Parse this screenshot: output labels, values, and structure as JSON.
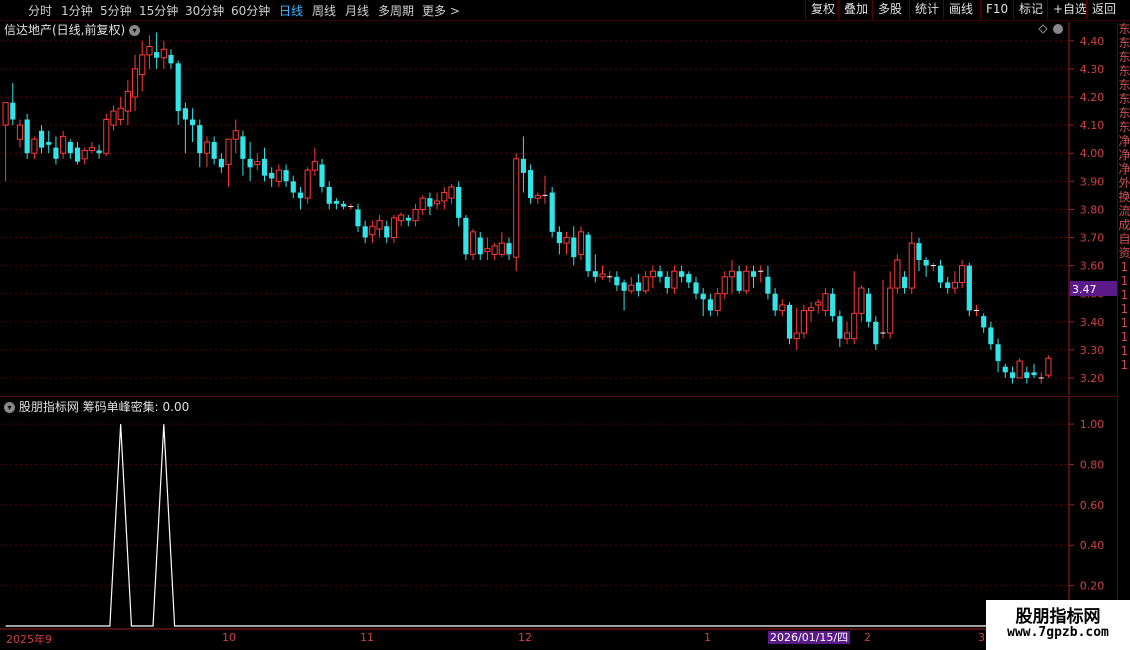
{
  "toolbar": {
    "periods": [
      "分时",
      "1分钟",
      "5分钟",
      "15分钟",
      "30分钟",
      "60分钟",
      "日线",
      "周线",
      "月线",
      "多周期",
      "更多 >"
    ],
    "active_period": "日线",
    "buttons": [
      "复权",
      "叠加",
      "多股",
      "统计",
      "画线",
      "F10",
      "标记",
      "+自选",
      "返回"
    ]
  },
  "chart": {
    "title": "信达地产(日线,前复权)",
    "current_price_tag": "3.47",
    "price_ticks": [
      "4.40",
      "4.30",
      "4.20",
      "4.10",
      "4.00",
      "3.90",
      "3.80",
      "3.70",
      "3.60",
      "3.50",
      "3.40",
      "3.30",
      "3.20"
    ]
  },
  "indicator": {
    "title": "股朋指标网  筹码单峰密集: 0.00",
    "ticks": [
      "1.00",
      "0.80",
      "0.60",
      "0.40",
      "0.20"
    ]
  },
  "xaxis": {
    "labels": [
      "2025年9",
      "10",
      "11",
      "12",
      "1",
      "2",
      "3"
    ],
    "cursor_date": "2026/01/15/四"
  },
  "right_strip": [
    "东",
    "东",
    "东",
    "东",
    "东",
    "东",
    "东",
    "东",
    "净",
    "净",
    "净",
    "外",
    "换",
    "流",
    "成",
    "自",
    "资",
    "1",
    "1",
    "1",
    "1",
    "1",
    "1",
    "1",
    "1"
  ],
  "watermark": {
    "name": "股朋指标网",
    "url": "www.7gpzb.com"
  },
  "colors": {
    "up": "#ff3a3a",
    "down": "#31e4e8",
    "grid": "#5a0000",
    "axis": "#d04040",
    "cursor": "#5a1a8a"
  },
  "chart_data": {
    "type": "candlestick",
    "title": "信达地产(日线,前复权)",
    "ylim": [
      3.15,
      4.46
    ],
    "candles": [
      [
        4.1,
        4.18,
        3.9,
        4.18
      ],
      [
        4.18,
        4.12,
        4.1,
        4.25
      ],
      [
        4.05,
        4.1,
        4.02,
        4.12
      ],
      [
        4.12,
        4.0,
        3.98,
        4.14
      ],
      [
        4.0,
        4.05,
        3.98,
        4.06
      ],
      [
        4.08,
        4.02,
        4.0,
        4.1
      ],
      [
        4.04,
        4.03,
        4.0,
        4.08
      ],
      [
        4.02,
        3.98,
        3.96,
        4.06
      ],
      [
        4.0,
        4.06,
        3.98,
        4.08
      ],
      [
        4.04,
        4.0,
        3.98,
        4.05
      ],
      [
        4.02,
        3.97,
        3.96,
        4.04
      ],
      [
        3.98,
        4.01,
        3.96,
        4.02
      ],
      [
        4.01,
        4.02,
        4.0,
        4.04
      ],
      [
        4.01,
        4.0,
        3.98,
        4.03
      ],
      [
        4.0,
        4.12,
        3.99,
        4.14
      ],
      [
        4.1,
        4.15,
        4.08,
        4.17
      ],
      [
        4.12,
        4.16,
        4.1,
        4.2
      ],
      [
        4.15,
        4.22,
        4.1,
        4.26
      ],
      [
        4.2,
        4.3,
        4.15,
        4.35
      ],
      [
        4.28,
        4.35,
        4.22,
        4.4
      ],
      [
        4.35,
        4.38,
        4.3,
        4.42
      ],
      [
        4.36,
        4.34,
        4.3,
        4.43
      ],
      [
        4.34,
        4.37,
        4.3,
        4.4
      ],
      [
        4.35,
        4.32,
        4.3,
        4.37
      ],
      [
        4.32,
        4.15,
        4.1,
        4.33
      ],
      [
        4.16,
        4.12,
        4.0,
        4.18
      ],
      [
        4.12,
        4.1,
        4.04,
        4.16
      ],
      [
        4.1,
        4.0,
        3.95,
        4.12
      ],
      [
        4.0,
        4.04,
        3.95,
        4.06
      ],
      [
        4.04,
        3.98,
        3.96,
        4.06
      ],
      [
        3.98,
        3.95,
        3.93,
        4.0
      ],
      [
        3.96,
        4.05,
        3.88,
        4.05
      ],
      [
        4.05,
        4.08,
        4.0,
        4.12
      ],
      [
        4.06,
        3.98,
        3.92,
        4.08
      ],
      [
        3.98,
        3.95,
        3.9,
        4.04
      ],
      [
        3.96,
        3.97,
        3.94,
        4.0
      ],
      [
        3.98,
        3.92,
        3.9,
        4.02
      ],
      [
        3.93,
        3.91,
        3.88,
        3.95
      ],
      [
        3.9,
        3.94,
        3.88,
        3.96
      ],
      [
        3.94,
        3.9,
        3.88,
        3.96
      ],
      [
        3.9,
        3.86,
        3.84,
        3.92
      ],
      [
        3.86,
        3.84,
        3.8,
        3.88
      ],
      [
        3.84,
        3.94,
        3.82,
        3.95
      ],
      [
        3.94,
        3.97,
        3.92,
        4.02
      ],
      [
        3.96,
        3.88,
        3.86,
        3.98
      ],
      [
        3.88,
        3.82,
        3.8,
        3.9
      ],
      [
        3.83,
        3.82,
        3.8,
        3.84
      ],
      [
        3.82,
        3.81,
        3.8,
        3.83
      ],
      [
        3.81,
        3.81,
        3.8,
        3.82
      ],
      [
        3.8,
        3.74,
        3.72,
        3.82
      ],
      [
        3.74,
        3.7,
        3.68,
        3.76
      ],
      [
        3.71,
        3.74,
        3.68,
        3.76
      ],
      [
        3.73,
        3.76,
        3.7,
        3.78
      ],
      [
        3.74,
        3.7,
        3.68,
        3.76
      ],
      [
        3.7,
        3.77,
        3.68,
        3.78
      ],
      [
        3.76,
        3.78,
        3.74,
        3.79
      ],
      [
        3.77,
        3.76,
        3.74,
        3.78
      ],
      [
        3.76,
        3.8,
        3.74,
        3.82
      ],
      [
        3.8,
        3.84,
        3.78,
        3.85
      ],
      [
        3.84,
        3.81,
        3.78,
        3.86
      ],
      [
        3.82,
        3.83,
        3.8,
        3.86
      ],
      [
        3.83,
        3.86,
        3.8,
        3.88
      ],
      [
        3.84,
        3.88,
        3.82,
        3.89
      ],
      [
        3.88,
        3.77,
        3.74,
        3.9
      ],
      [
        3.77,
        3.64,
        3.62,
        3.78
      ],
      [
        3.64,
        3.72,
        3.62,
        3.73
      ],
      [
        3.7,
        3.64,
        3.62,
        3.72
      ],
      [
        3.65,
        3.66,
        3.62,
        3.7
      ],
      [
        3.64,
        3.67,
        3.62,
        3.68
      ],
      [
        3.64,
        3.68,
        3.63,
        3.72
      ],
      [
        3.68,
        3.64,
        3.62,
        3.7
      ],
      [
        3.63,
        3.98,
        3.58,
        4.0
      ],
      [
        3.98,
        3.93,
        3.86,
        4.06
      ],
      [
        3.94,
        3.84,
        3.82,
        3.96
      ],
      [
        3.84,
        3.85,
        3.82,
        3.86
      ],
      [
        3.85,
        3.85,
        3.82,
        3.92
      ],
      [
        3.86,
        3.72,
        3.7,
        3.88
      ],
      [
        3.72,
        3.68,
        3.64,
        3.74
      ],
      [
        3.68,
        3.7,
        3.64,
        3.72
      ],
      [
        3.7,
        3.63,
        3.6,
        3.74
      ],
      [
        3.64,
        3.72,
        3.62,
        3.74
      ],
      [
        3.71,
        3.58,
        3.56,
        3.72
      ],
      [
        3.58,
        3.56,
        3.54,
        3.64
      ],
      [
        3.56,
        3.57,
        3.55,
        3.6
      ],
      [
        3.56,
        3.56,
        3.54,
        3.58
      ],
      [
        3.56,
        3.53,
        3.51,
        3.58
      ],
      [
        3.54,
        3.51,
        3.44,
        3.55
      ],
      [
        3.51,
        3.53,
        3.5,
        3.56
      ],
      [
        3.54,
        3.51,
        3.49,
        3.57
      ],
      [
        3.51,
        3.56,
        3.5,
        3.58
      ],
      [
        3.56,
        3.58,
        3.52,
        3.6
      ],
      [
        3.58,
        3.56,
        3.54,
        3.6
      ],
      [
        3.56,
        3.52,
        3.5,
        3.58
      ],
      [
        3.52,
        3.58,
        3.5,
        3.6
      ],
      [
        3.58,
        3.56,
        3.54,
        3.6
      ],
      [
        3.57,
        3.54,
        3.52,
        3.58
      ],
      [
        3.54,
        3.5,
        3.48,
        3.56
      ],
      [
        3.5,
        3.48,
        3.42,
        3.52
      ],
      [
        3.48,
        3.44,
        3.42,
        3.5
      ],
      [
        3.44,
        3.5,
        3.42,
        3.52
      ],
      [
        3.5,
        3.56,
        3.48,
        3.58
      ],
      [
        3.56,
        3.58,
        3.5,
        3.62
      ],
      [
        3.58,
        3.51,
        3.5,
        3.6
      ],
      [
        3.51,
        3.58,
        3.5,
        3.6
      ],
      [
        3.58,
        3.56,
        3.52,
        3.6
      ],
      [
        3.58,
        3.58,
        3.54,
        3.6
      ],
      [
        3.56,
        3.5,
        3.48,
        3.6
      ],
      [
        3.5,
        3.44,
        3.42,
        3.52
      ],
      [
        3.44,
        3.46,
        3.42,
        3.48
      ],
      [
        3.46,
        3.34,
        3.32,
        3.47
      ],
      [
        3.34,
        3.36,
        3.3,
        3.45
      ],
      [
        3.36,
        3.44,
        3.34,
        3.46
      ],
      [
        3.44,
        3.45,
        3.4,
        3.47
      ],
      [
        3.46,
        3.47,
        3.43,
        3.48
      ],
      [
        3.44,
        3.5,
        3.42,
        3.52
      ],
      [
        3.5,
        3.42,
        3.4,
        3.52
      ],
      [
        3.42,
        3.34,
        3.31,
        3.44
      ],
      [
        3.34,
        3.36,
        3.32,
        3.4
      ],
      [
        3.34,
        3.43,
        3.32,
        3.58
      ],
      [
        3.43,
        3.52,
        3.4,
        3.53
      ],
      [
        3.5,
        3.4,
        3.38,
        3.52
      ],
      [
        3.4,
        3.32,
        3.3,
        3.42
      ],
      [
        3.36,
        3.36,
        3.34,
        3.55
      ],
      [
        3.36,
        3.52,
        3.34,
        3.58
      ],
      [
        3.52,
        3.62,
        3.5,
        3.64
      ],
      [
        3.56,
        3.52,
        3.5,
        3.58
      ],
      [
        3.52,
        3.68,
        3.5,
        3.72
      ],
      [
        3.68,
        3.62,
        3.58,
        3.7
      ],
      [
        3.62,
        3.6,
        3.56,
        3.63
      ],
      [
        3.6,
        3.6,
        3.58,
        3.61
      ],
      [
        3.6,
        3.54,
        3.52,
        3.62
      ],
      [
        3.54,
        3.52,
        3.5,
        3.56
      ],
      [
        3.52,
        3.54,
        3.5,
        3.58
      ],
      [
        3.54,
        3.6,
        3.52,
        3.62
      ],
      [
        3.6,
        3.44,
        3.42,
        3.61
      ],
      [
        3.44,
        3.44,
        3.42,
        3.46
      ],
      [
        3.42,
        3.38,
        3.36,
        3.43
      ],
      [
        3.38,
        3.32,
        3.3,
        3.4
      ],
      [
        3.32,
        3.26,
        3.22,
        3.34
      ],
      [
        3.24,
        3.22,
        3.2,
        3.25
      ],
      [
        3.22,
        3.2,
        3.18,
        3.24
      ],
      [
        3.2,
        3.26,
        3.2,
        3.27
      ],
      [
        3.22,
        3.2,
        3.18,
        3.24
      ],
      [
        3.22,
        3.21,
        3.2,
        3.25
      ],
      [
        3.2,
        3.2,
        3.18,
        3.22
      ],
      [
        3.21,
        3.27,
        3.2,
        3.28
      ]
    ],
    "indicator": {
      "name": "筹码单峰密集",
      "ylim": [
        0,
        1.05
      ],
      "spikes": [
        {
          "bar": 16,
          "value": 1.0
        },
        {
          "bar": 22,
          "value": 1.0
        }
      ]
    }
  }
}
